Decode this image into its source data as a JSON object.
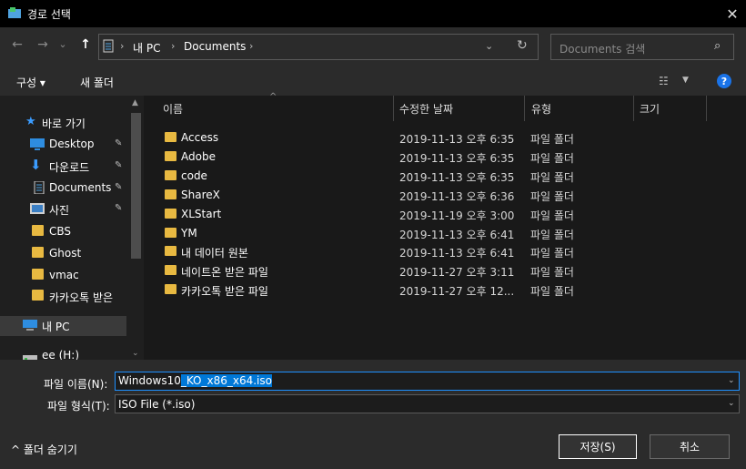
{
  "window": {
    "title": "경로 선택",
    "close_icon": "✕"
  },
  "nav": {
    "back_icon": "←",
    "forward_icon": "→",
    "history_icon": "⌄",
    "up_icon": "↑"
  },
  "address": {
    "breadcrumb": [
      "내 PC",
      "Documents"
    ],
    "separator": "›",
    "dropdown_icon": "⌄",
    "refresh_icon": "↻"
  },
  "search": {
    "placeholder": "Documents 검색",
    "icon": "⌕"
  },
  "toolbar": {
    "organize_label": "구성 ▾",
    "new_folder_label": "새 폴더",
    "view_icon": "☷",
    "view_dd": "▼",
    "help_label": "?"
  },
  "sidebar": {
    "items": [
      {
        "label": "바로 가기",
        "icon": "star-icon"
      },
      {
        "label": "Desktop",
        "icon": "desktop-icon",
        "pinned": true
      },
      {
        "label": "다운로드",
        "icon": "download-icon",
        "pinned": true
      },
      {
        "label": "Documents",
        "icon": "document-icon",
        "pinned": true
      },
      {
        "label": "사진",
        "icon": "picture-icon",
        "pinned": true
      },
      {
        "label": "CBS",
        "icon": "folder-icon"
      },
      {
        "label": "Ghost",
        "icon": "folder-icon"
      },
      {
        "label": "vmac",
        "icon": "folder-icon"
      },
      {
        "label": "카카오톡 받은",
        "icon": "folder-icon"
      },
      {
        "label": "내 PC",
        "icon": "pc-icon",
        "selected": true
      },
      {
        "label": "ee (H:)",
        "icon": "drive-icon"
      }
    ],
    "pin_glyph": "📌"
  },
  "columns": {
    "name": "이름",
    "modified": "수정한 날짜",
    "type": "유형",
    "size": "크기"
  },
  "files": [
    {
      "name": "Access",
      "modified": "2019-11-13 오후 6:35",
      "type": "파일 폴더"
    },
    {
      "name": "Adobe",
      "modified": "2019-11-13 오후 6:35",
      "type": "파일 폴더"
    },
    {
      "name": "code",
      "modified": "2019-11-13 오후 6:35",
      "type": "파일 폴더"
    },
    {
      "name": "ShareX",
      "modified": "2019-11-13 오후 6:36",
      "type": "파일 폴더"
    },
    {
      "name": "XLStart",
      "modified": "2019-11-19 오후 3:00",
      "type": "파일 폴더"
    },
    {
      "name": "YM",
      "modified": "2019-11-13 오후 6:41",
      "type": "파일 폴더"
    },
    {
      "name": "내 데이터 원본",
      "modified": "2019-11-13 오후 6:41",
      "type": "파일 폴더"
    },
    {
      "name": "네이트온 받은 파일",
      "modified": "2019-11-27 오후 3:11",
      "type": "파일 폴더"
    },
    {
      "name": "카카오톡 받은 파일",
      "modified": "2019-11-27 오후 12...",
      "type": "파일 폴더"
    }
  ],
  "filename": {
    "label": "파일 이름(N):",
    "value_prefix": "Windows10",
    "value_selected": "_KO_x86_x64.iso",
    "dropdown_icon": "⌄"
  },
  "filetype": {
    "label": "파일 형식(T):",
    "value": "ISO File (*.iso)",
    "dropdown_icon": "⌄"
  },
  "footer": {
    "hide_folders_label": "^ 폴더 숨기기",
    "save_label": "저장(S)",
    "cancel_label": "취소"
  },
  "colors": {
    "accent": "#0078d7",
    "folder": "#e8b941",
    "help": "#1a73e8"
  }
}
